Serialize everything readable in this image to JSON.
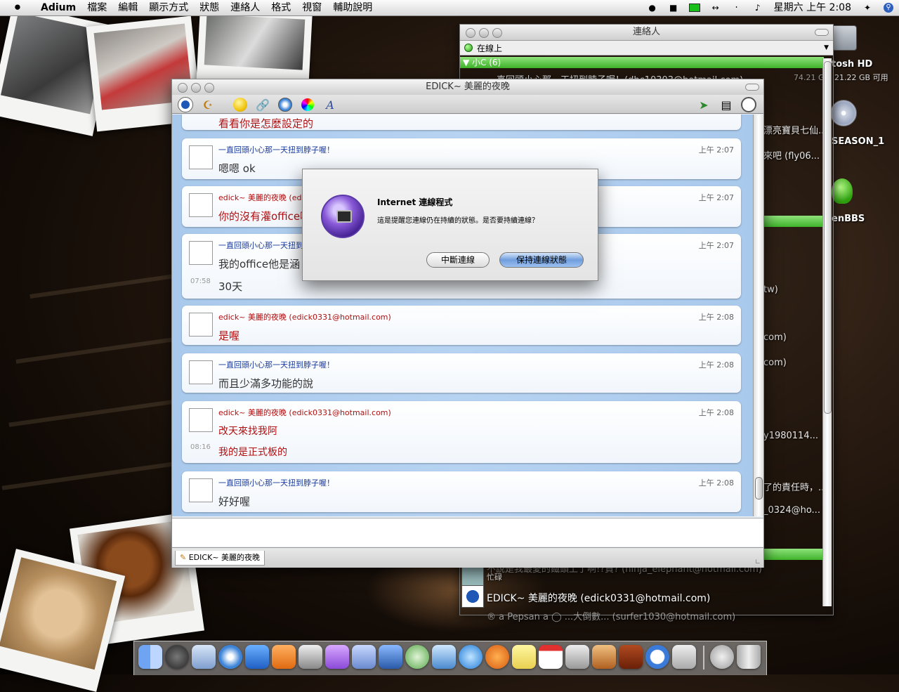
{
  "menubar": {
    "app": "Adium",
    "items": [
      "檔案",
      "編輯",
      "顯示方式",
      "狀態",
      "連絡人",
      "格式",
      "視窗",
      "輔助說明"
    ],
    "clock": "星期六 上午 2:08"
  },
  "desktop": {
    "hd_name": "tosh HD",
    "hd_info": "74.21 GB, 21.22 GB 可用",
    "dvd_label": "SEASON_1",
    "green_label": "enBBS"
  },
  "contacts": {
    "title": "連絡人",
    "status": "在線上",
    "group_label": "小C (6)",
    "row_top": "真回頭小心那一天扭到脖子喔！(dhc10303@hotmail.com)",
    "side_lines": [
      "漂亮寶貝七仙...",
      "來吧 (fly06...",
      "tw)",
      "com)",
      "com)",
      "y1980114...",
      "了的責任時，...",
      "_0324@ho..."
    ],
    "row_cut": "不說是我最愛的鐵頭上了啊!?貧? (ninja_elephant@hotmail.com)",
    "row_cut_status": "忙碌",
    "row_edick": "EDICK~ 美麗的夜晚 (edick0331@hotmail.com)",
    "row_cut2": "® a Pepsan a ◯ ...大倒數... (surfer1030@hotmail.com)"
  },
  "chat": {
    "title": "EDICK~ 美麗的夜晚",
    "tab_label": "EDICK~ 美麗的夜晚",
    "top_partial": "看看你是怎麼設定的",
    "messages": [
      {
        "sender": "一直回頭小心那一天扭到脖子喔！",
        "time": "上午 2:07",
        "lines": [
          "嗯嗯 ok"
        ]
      },
      {
        "sender": "edick~ 美麗的夜晚 (edic",
        "time": "上午 2:07",
        "lines": [
          "你的沒有灌office嘛"
        ]
      },
      {
        "sender": "一直回頭小心那一天扭到",
        "time": "上午 2:07",
        "lines": [
          "我的office他是涵",
          "30天"
        ],
        "stamp": "07:58"
      },
      {
        "sender": "edick~ 美麗的夜晚 (edick0331@hotmail.com)",
        "time": "上午 2:08",
        "lines": [
          "是喔"
        ]
      },
      {
        "sender": "一直回頭小心那一天扭到脖子喔！",
        "time": "上午 2:08",
        "lines": [
          "而且少滿多功能的說"
        ]
      },
      {
        "sender": "edick~ 美麗的夜晚 (edick0331@hotmail.com)",
        "time": "上午 2:08",
        "lines": [
          "改天來找我阿",
          "我的是正式板的"
        ],
        "stamp": "08:16"
      },
      {
        "sender": "一直回頭小心那一天扭到脖子喔！",
        "time": "上午 2:08",
        "lines": [
          "好好喔"
        ]
      }
    ]
  },
  "dialog": {
    "title": "Internet 連線程式",
    "body": "這是提醒您連線仍在持續的狀態。是否要持續連線？",
    "btn_disconnect": "中斷連線",
    "btn_keep": "保持連線狀態"
  }
}
